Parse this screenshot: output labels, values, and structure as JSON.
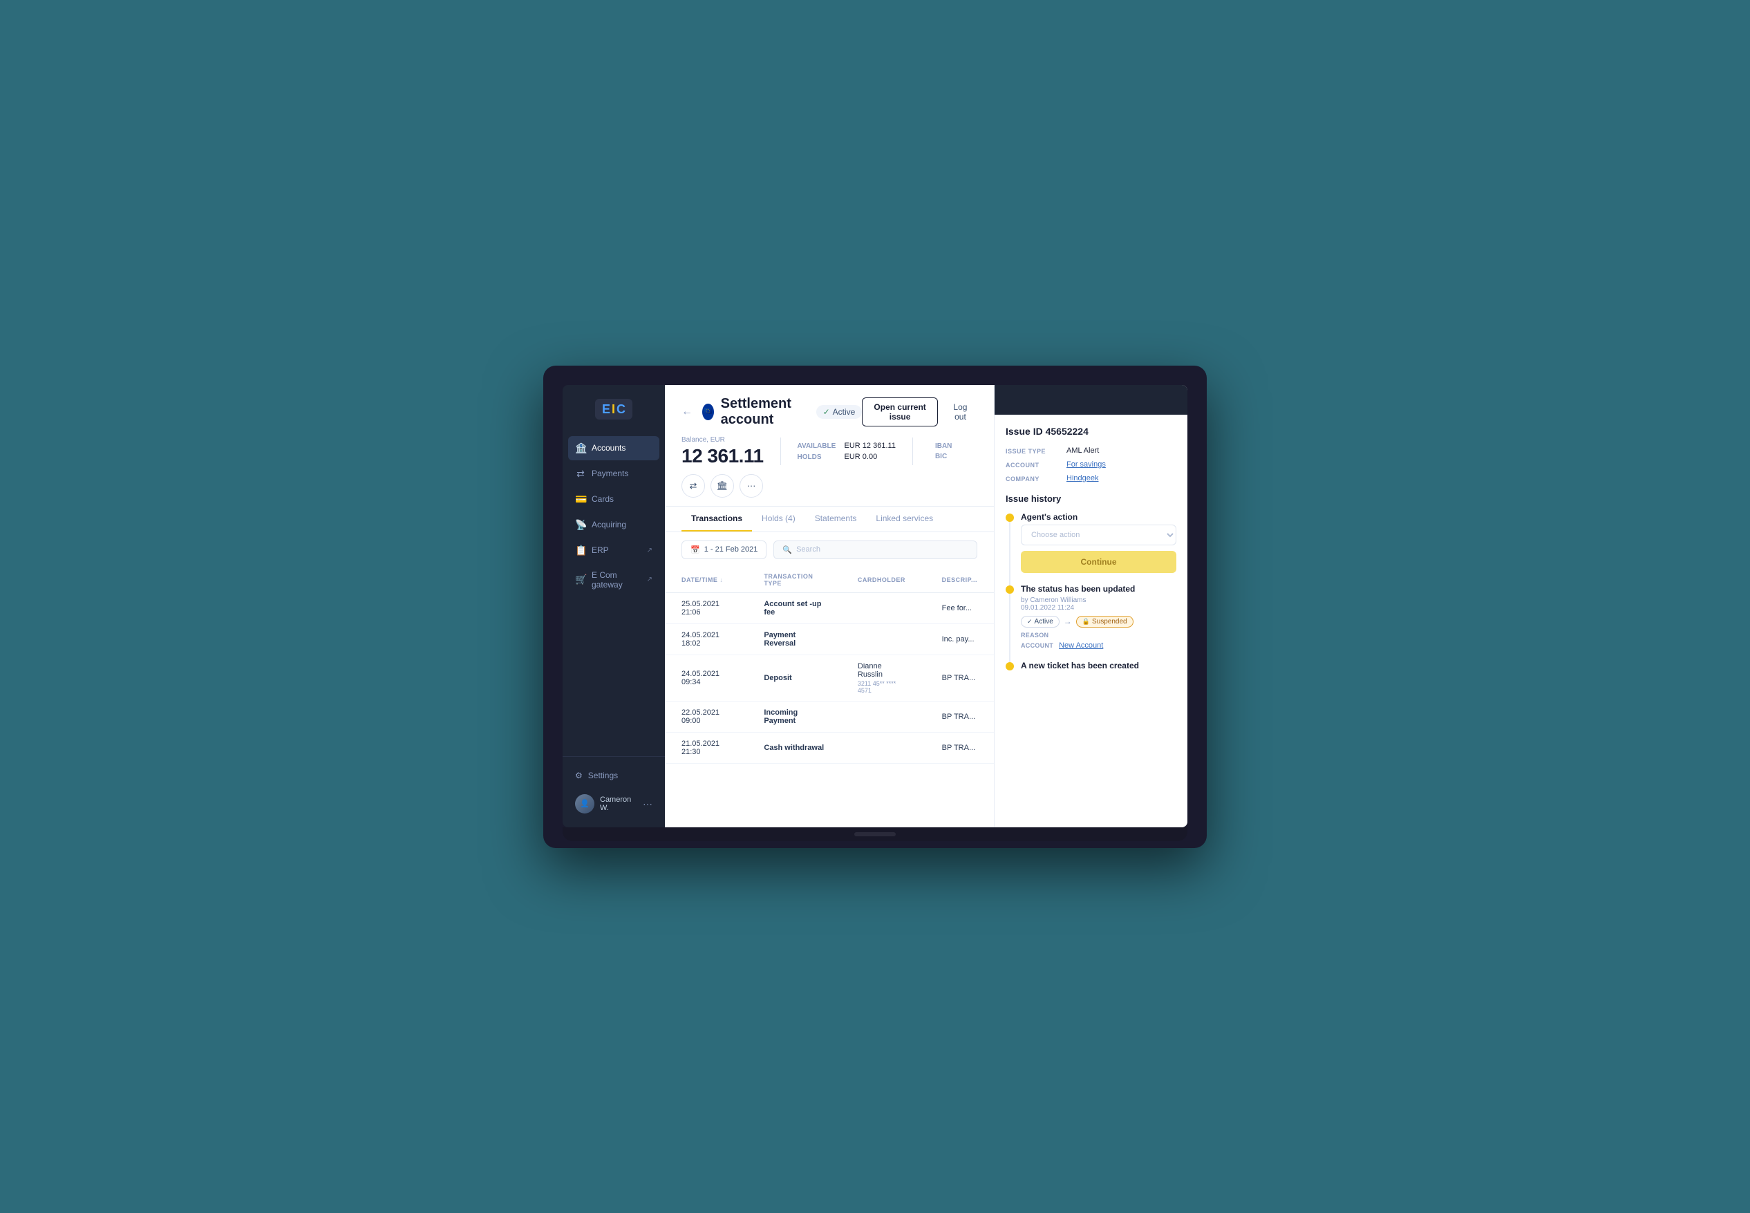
{
  "app": {
    "logo": {
      "letter1": "E",
      "letter2": "I",
      "letter3": "C"
    }
  },
  "sidebar": {
    "items": [
      {
        "id": "accounts",
        "label": "Accounts",
        "icon": "🏦",
        "active": true
      },
      {
        "id": "payments",
        "label": "Payments",
        "icon": "⇄",
        "active": false
      },
      {
        "id": "cards",
        "label": "Cards",
        "icon": "💳",
        "active": false
      },
      {
        "id": "acquiring",
        "label": "Acquiring",
        "icon": "📡",
        "active": false
      },
      {
        "id": "erp",
        "label": "ERP",
        "icon": "📋",
        "active": false,
        "ext": "↗"
      },
      {
        "id": "ecom",
        "label": "E Com gateway",
        "icon": "🛒",
        "active": false,
        "ext": "↗"
      }
    ],
    "settings_label": "Settings",
    "user_name": "Cameron W."
  },
  "header": {
    "back_label": "←",
    "account_title": "Settlement account",
    "status_label": "Active",
    "open_issue_btn": "Open current issue",
    "logout_btn": "Log out",
    "balance_label": "Balance, EUR",
    "balance_amount": "12 361.11",
    "available_key": "AVAILABLE",
    "available_val": "EUR  12 361.11",
    "holds_key": "HOLDS",
    "holds_val": "EUR  0.00",
    "iban_key": "IBAN",
    "bic_key": "BIC"
  },
  "tabs": [
    {
      "id": "transactions",
      "label": "Transactions",
      "active": true
    },
    {
      "id": "holds",
      "label": "Holds (4)",
      "active": false
    },
    {
      "id": "statements",
      "label": "Statements",
      "active": false
    },
    {
      "id": "linked",
      "label": "Linked services",
      "active": false
    }
  ],
  "filter": {
    "date_label": "1 - 21 Feb 2021",
    "search_placeholder": "Search"
  },
  "table": {
    "columns": [
      "DATE/TIME",
      "TRANSACTION TYPE",
      "CARDHOLDER",
      "DESCRIP..."
    ],
    "rows": [
      {
        "datetime": "25.05.2021  21:06",
        "type": "Account set -up fee",
        "cardholder": "",
        "desc": "Fee for..."
      },
      {
        "datetime": "24.05.2021  18:02",
        "type": "Payment Reversal",
        "cardholder": "",
        "desc": "Inc. pay..."
      },
      {
        "datetime": "24.05.2021  09:34",
        "type": "Deposit",
        "cardholder": "Dianne Russlin",
        "cardholder_sub": "3211 45** **** 4571",
        "desc": "BP TRA..."
      },
      {
        "datetime": "22.05.2021  09:00",
        "type": "Incoming Payment",
        "cardholder": "",
        "desc": "BP TRA..."
      },
      {
        "datetime": "21.05.2021  21:30",
        "type": "Cash withdrawal",
        "cardholder": "",
        "desc": "BP TRA..."
      }
    ]
  },
  "right_panel": {
    "header_label": "",
    "issue_id": "Issue ID 45652224",
    "meta": [
      {
        "key": "ISSUE TYPE",
        "value": "AML Alert",
        "link": false
      },
      {
        "key": "ACCOUNT",
        "value": "For savings",
        "link": true
      },
      {
        "key": "COMPANY",
        "value": "Hindgeek",
        "link": true
      }
    ],
    "history_title": "Issue history",
    "history_items": [
      {
        "title": "Agent's action",
        "sub": "",
        "type": "action",
        "action_placeholder": "Choose action",
        "continue_label": "Continue"
      },
      {
        "title": "The status has been updated",
        "sub": "by Cameron Williams",
        "date": "09.01.2022  11:24",
        "type": "status_update",
        "from_status": "Active",
        "to_status": "Suspended",
        "reason_key": "Reason",
        "account_key": "ACCOUNT",
        "account_val": "New Account"
      },
      {
        "title": "A new ticket has been created",
        "type": "ticket_created"
      }
    ]
  }
}
